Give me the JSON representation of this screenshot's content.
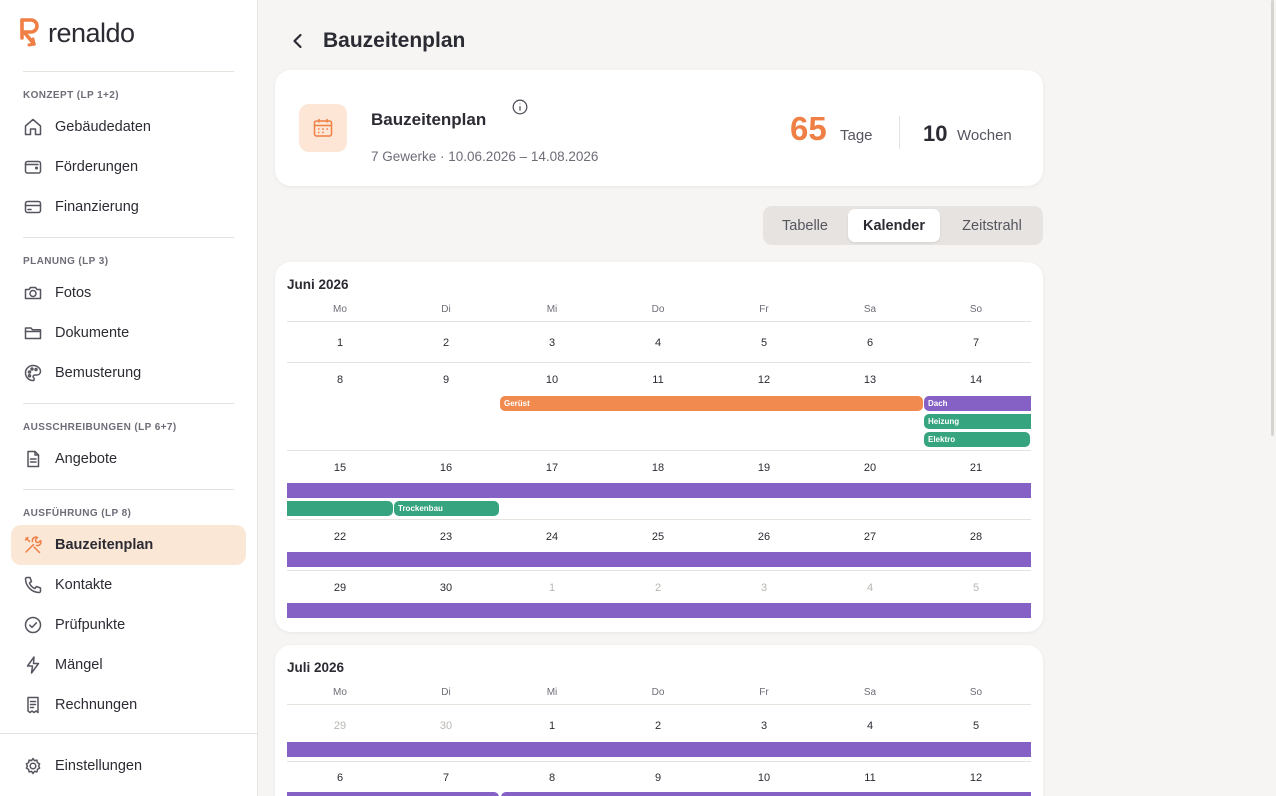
{
  "brand": {
    "name": "renaldo",
    "accent": "#ef7f45"
  },
  "sidebar": {
    "sections": [
      {
        "title": "KONZEPT (LP 1+2)",
        "items": [
          {
            "label": "Gebäudedaten",
            "icon": "home-icon"
          },
          {
            "label": "Förderungen",
            "icon": "wallet-icon"
          },
          {
            "label": "Finanzierung",
            "icon": "credit-card-icon"
          }
        ]
      },
      {
        "title": "PLANUNG (LP 3)",
        "items": [
          {
            "label": "Fotos",
            "icon": "camera-icon"
          },
          {
            "label": "Dokumente",
            "icon": "folder-icon"
          },
          {
            "label": "Bemusterung",
            "icon": "palette-icon"
          }
        ]
      },
      {
        "title": "AUSSCHREIBUNGEN (LP 6+7)",
        "items": [
          {
            "label": "Angebote",
            "icon": "document-icon"
          }
        ]
      },
      {
        "title": "AUSFÜHRUNG (LP 8)",
        "items": [
          {
            "label": "Bauzeitenplan",
            "icon": "tools-icon",
            "active": true
          },
          {
            "label": "Kontakte",
            "icon": "phone-icon"
          },
          {
            "label": "Prüfpunkte",
            "icon": "check-circle-icon"
          },
          {
            "label": "Mängel",
            "icon": "lightning-icon"
          },
          {
            "label": "Rechnungen",
            "icon": "receipt-icon"
          }
        ]
      }
    ],
    "footer": {
      "label": "Einstellungen",
      "icon": "gear-icon"
    }
  },
  "header": {
    "back_icon": "chevron-left-icon",
    "title": "Bauzeitenplan"
  },
  "summary": {
    "title": "Bauzeitenplan",
    "subtitle": "7 Gewerke · 10.06.2026 – 14.08.2026",
    "days_value": "65",
    "days_label": "Tage",
    "weeks_value": "10",
    "weeks_label": "Wochen"
  },
  "view_toggle": {
    "options": [
      "Tabelle",
      "Kalender",
      "Zeitstrahl"
    ],
    "selected": "Kalender"
  },
  "weekdays": [
    "Mo",
    "Di",
    "Mi",
    "Do",
    "Fr",
    "Sa",
    "So"
  ],
  "colors": {
    "orange": "#f08a4f",
    "purple": "#8661c5",
    "green": "#36a47f"
  },
  "months": [
    {
      "title": "Juni 2026",
      "weeks": [
        {
          "days": [
            "1",
            "2",
            "3",
            "4",
            "5",
            "6",
            "7"
          ],
          "muted": []
        },
        {
          "days": [
            "8",
            "9",
            "10",
            "11",
            "12",
            "13",
            "14"
          ],
          "muted": []
        },
        {
          "days": [
            "15",
            "16",
            "17",
            "18",
            "19",
            "20",
            "21"
          ],
          "muted": []
        },
        {
          "days": [
            "22",
            "23",
            "24",
            "25",
            "26",
            "27",
            "28"
          ],
          "muted": []
        },
        {
          "days": [
            "29",
            "30",
            "1",
            "2",
            "3",
            "4",
            "5"
          ],
          "muted": [
            2,
            3,
            4,
            5,
            6
          ]
        }
      ],
      "events": [
        {
          "label": "Gerüst",
          "color": "orange"
        },
        {
          "label": "Dach",
          "color": "purple"
        },
        {
          "label": "Heizung",
          "color": "green"
        },
        {
          "label": "Elektro",
          "color": "green"
        },
        {
          "label": "Trockenbau",
          "color": "green"
        }
      ]
    },
    {
      "title": "Juli 2026",
      "weeks": [
        {
          "days": [
            "29",
            "30",
            "1",
            "2",
            "3",
            "4",
            "5"
          ],
          "muted": [
            0,
            1
          ]
        },
        {
          "days": [
            "6",
            "7",
            "8",
            "9",
            "10",
            "11",
            "12"
          ],
          "muted": []
        }
      ]
    }
  ]
}
